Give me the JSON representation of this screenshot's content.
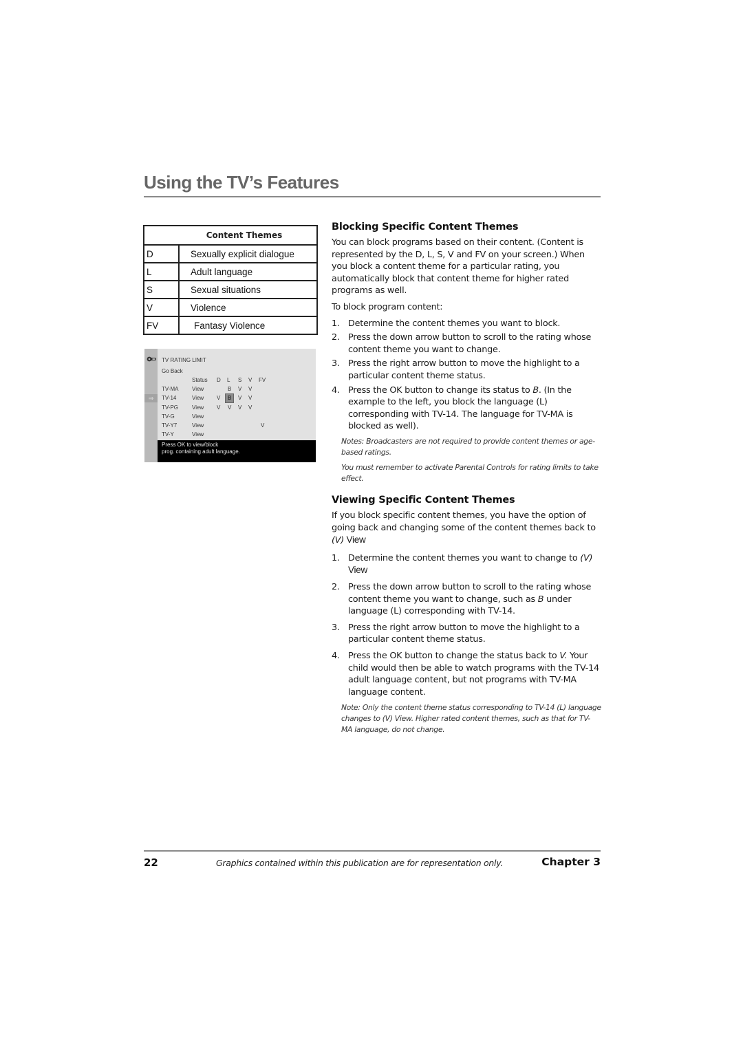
{
  "header": {
    "title": "Using the TV’s Features"
  },
  "content_themes_table": {
    "heading": "Content Themes",
    "rows": [
      {
        "code": "D",
        "description": "Sexually explicit dialogue"
      },
      {
        "code": "L",
        "description": "Adult language"
      },
      {
        "code": "S",
        "description": "Sexual situations"
      },
      {
        "code": "V",
        "description": "Violence"
      },
      {
        "code": "FV",
        "description": "Fantasy Violence"
      }
    ]
  },
  "tv_screen": {
    "title": "TV RATING LIMIT",
    "go_back": "Go Back",
    "columns": [
      "Status",
      "D",
      "L",
      "S",
      "V",
      "FV"
    ],
    "rows": [
      {
        "rating": "TV-MA",
        "status": "View",
        "D": "",
        "L": "B",
        "S": "V",
        "V": "V",
        "FV": ""
      },
      {
        "rating": "TV-14",
        "status": "View",
        "D": "V",
        "L": "B",
        "S": "V",
        "V": "V",
        "FV": ""
      },
      {
        "rating": "TV-PG",
        "status": "View",
        "D": "V",
        "L": "V",
        "S": "V",
        "V": "V",
        "FV": ""
      },
      {
        "rating": "TV-G",
        "status": "View",
        "D": "",
        "L": "",
        "S": "",
        "V": "",
        "FV": ""
      },
      {
        "rating": "TV-Y7",
        "status": "View",
        "D": "",
        "L": "",
        "S": "",
        "V": "",
        "FV": "V"
      },
      {
        "rating": "TV-Y",
        "status": "View",
        "D": "",
        "L": "",
        "S": "",
        "V": "",
        "FV": ""
      }
    ],
    "highlighted": {
      "rating": "TV-14",
      "column": "L"
    },
    "message_line1": "Press OK to view/block",
    "message_line2": "prog. containing adult language.",
    "icons": {
      "top": "key-icon",
      "selected_row": "arrow-right-icon"
    }
  },
  "blocking_section": {
    "heading": "Blocking Specific Content Themes",
    "intro": "You can block programs based on their content. (Content is represented by the D, L, S, V and FV on your screen.) When you block a content theme for a particular rating, you automatically block that content theme for higher rated programs as well.",
    "lead": "To block program content:",
    "steps": [
      {
        "num": "1.",
        "text": "Determine the content themes you want to block."
      },
      {
        "num": "2.",
        "text": "Press the down arrow button to scroll to the rating whose content theme you want to change."
      },
      {
        "num": "3.",
        "text": "Press the right arrow button to move the highlight to a particular content theme status."
      },
      {
        "num": "4.",
        "text_before": "Press the OK button to change its status to ",
        "italic": "B",
        "text_after": ". (In the example to the left, you block the language (L) corresponding with TV-14. The language for TV-MA is blocked as well)."
      }
    ],
    "note1": "Notes: Broadcasters are not required to provide content themes or age-based ratings.",
    "note2": "You must remember to activate Parental Controls for rating limits to take effect."
  },
  "viewing_section": {
    "heading": "Viewing Specific Content Themes",
    "intro_before": "If you block specific content themes, you have the option of going back and changing some of the content themes back to ",
    "intro_italic": "(V)",
    "intro_view": " View",
    "steps": [
      {
        "num": "1.",
        "text": "Determine the content themes you want to change to ",
        "italic": "(V)",
        "view": "View"
      },
      {
        "num": "2.",
        "text_before": "Press the down arrow button to scroll to the rating whose content theme you want to change, such as ",
        "italic": "B",
        "text_after": " under language (L) corresponding with TV-14."
      },
      {
        "num": "3.",
        "text": "Press the right arrow button to move the highlight to a particular content theme status."
      },
      {
        "num": "4.",
        "text_before": "Press the OK button to change the status back to ",
        "italic": "V.",
        "text_after": "  Your child would then be able to watch programs with the TV-14 adult language content, but not programs with TV-MA language content."
      }
    ],
    "note": "Note:  Only the content theme status corresponding to TV-14  (L) language changes to (V) View. Higher rated content themes, such as that for TV-MA language, do not change."
  },
  "footer": {
    "page_number": "22",
    "disclaimer": "Graphics contained within this publication are for representation only.",
    "chapter": "Chapter 3"
  }
}
